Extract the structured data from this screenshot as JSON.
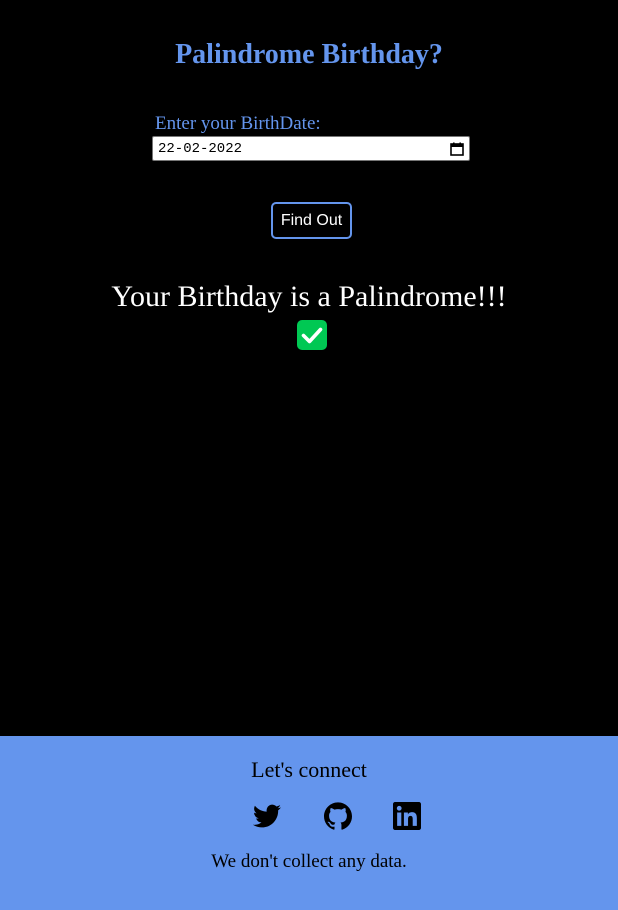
{
  "app": {
    "title": "Palindrome Birthday?"
  },
  "form": {
    "date_label": "Enter your BirthDate:",
    "date_value": "22-02-2022",
    "find_button_label": "Find Out"
  },
  "result": {
    "message": "Your Birthday is a Palindrome!!!",
    "status_icon": "check-square-icon",
    "status_color": "#00c853"
  },
  "footer": {
    "heading": "Let's connect",
    "links": [
      {
        "icon": "twitter-icon"
      },
      {
        "icon": "github-icon"
      },
      {
        "icon": "linkedin-icon"
      }
    ],
    "note": "We don't collect any data."
  },
  "colors": {
    "accent": "#6495ed",
    "background": "#000000",
    "text_light": "#ffffff",
    "text_dark": "#000000"
  }
}
